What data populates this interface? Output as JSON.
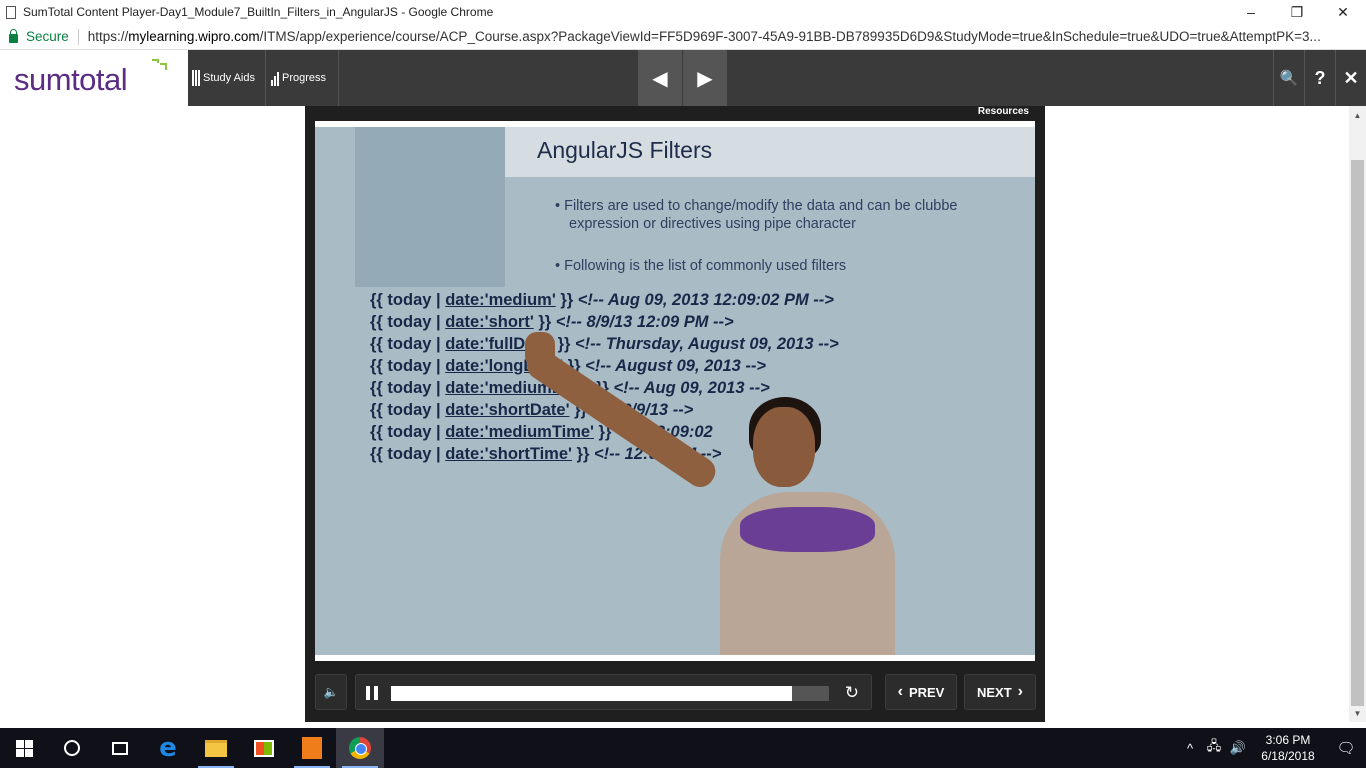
{
  "window": {
    "title": "SumTotal Content Player-Day1_Module7_BuiltIn_Filters_in_AngularJS - Google Chrome",
    "minimize": "–",
    "restore": "❐",
    "close": "✕"
  },
  "address_bar": {
    "secure_label": "Secure",
    "url_scheme": "https://",
    "url_host": "mylearning.wipro.com",
    "url_rest": "/ITMS/app/experience/course/ACP_Course.aspx?PackageViewId=FF5D969F-3007-45A9-91BB-DB789935D6D9&StudyMode=true&InSchedule=true&UDO=true&AttemptPK=3..."
  },
  "app_header": {
    "logo_text": "sumtotal",
    "study_aids_label": "Study Aids",
    "progress_label": "Progress",
    "prev_arrow": "◀",
    "next_arrow": "▶",
    "search_glyph": "🔍",
    "help_glyph": "?",
    "close_glyph": "✕"
  },
  "player": {
    "resources_label": "Resources",
    "slide": {
      "title": "AngularJS Filters",
      "bullet_1": "• Filters are used to change/modify the data and can be clubbe",
      "bullet_1b": "expression or directives using pipe character",
      "bullet_2": "• Following is the list of commonly used filters",
      "code": [
        {
          "pre": "{{ today | ",
          "filter": "date:'medium'",
          "post": " }} ",
          "comment": "<!-- Aug 09, 2013 12:09:02 PM -->"
        },
        {
          "pre": "{{ today | ",
          "filter": "date:'short'",
          "post": " }} ",
          "comment": "<!-- 8/9/13 12:09 PM -->"
        },
        {
          "pre": "{{ today | ",
          "filter": "date:'fullDate'",
          "post": " }} ",
          "comment": "<!-- Thursday, August 09, 2013 -->"
        },
        {
          "pre": "{{ today | ",
          "filter": "date:'longDate'",
          "post": " }} ",
          "comment": "<!-- August 09, 2013 -->"
        },
        {
          "pre": "{{ today | ",
          "filter": "date:'mediumDate'",
          "post": " }} ",
          "comment": "<!-- Aug 09, 2013 -->"
        },
        {
          "pre": "{{ today | ",
          "filter": "date:'shortDate'",
          "post": " }} ",
          "comment": "<!-- 8/9/13 -->"
        },
        {
          "pre": "{{ today | ",
          "filter": "date:'mediumTime'",
          "post": " }} ",
          "comment": "<!-- 12:09:02"
        },
        {
          "pre": "{{ today | ",
          "filter": "date:'shortTime'",
          "post": " }} ",
          "comment": "<!-- 12:09 PM -->"
        }
      ]
    },
    "controls": {
      "mute_glyph": "🔈",
      "progress_fraction": 0.915,
      "replay_glyph": "↻",
      "prev_label": "PREV",
      "next_label": "NEXT",
      "prev_chevron": "‹",
      "next_chevron": "›"
    }
  },
  "taskbar": {
    "tray_up": "^",
    "network_glyph": "🖧",
    "volume_glyph": "🔊",
    "time": "3:06 PM",
    "date": "6/18/2018",
    "notification_glyph": "🗨"
  }
}
